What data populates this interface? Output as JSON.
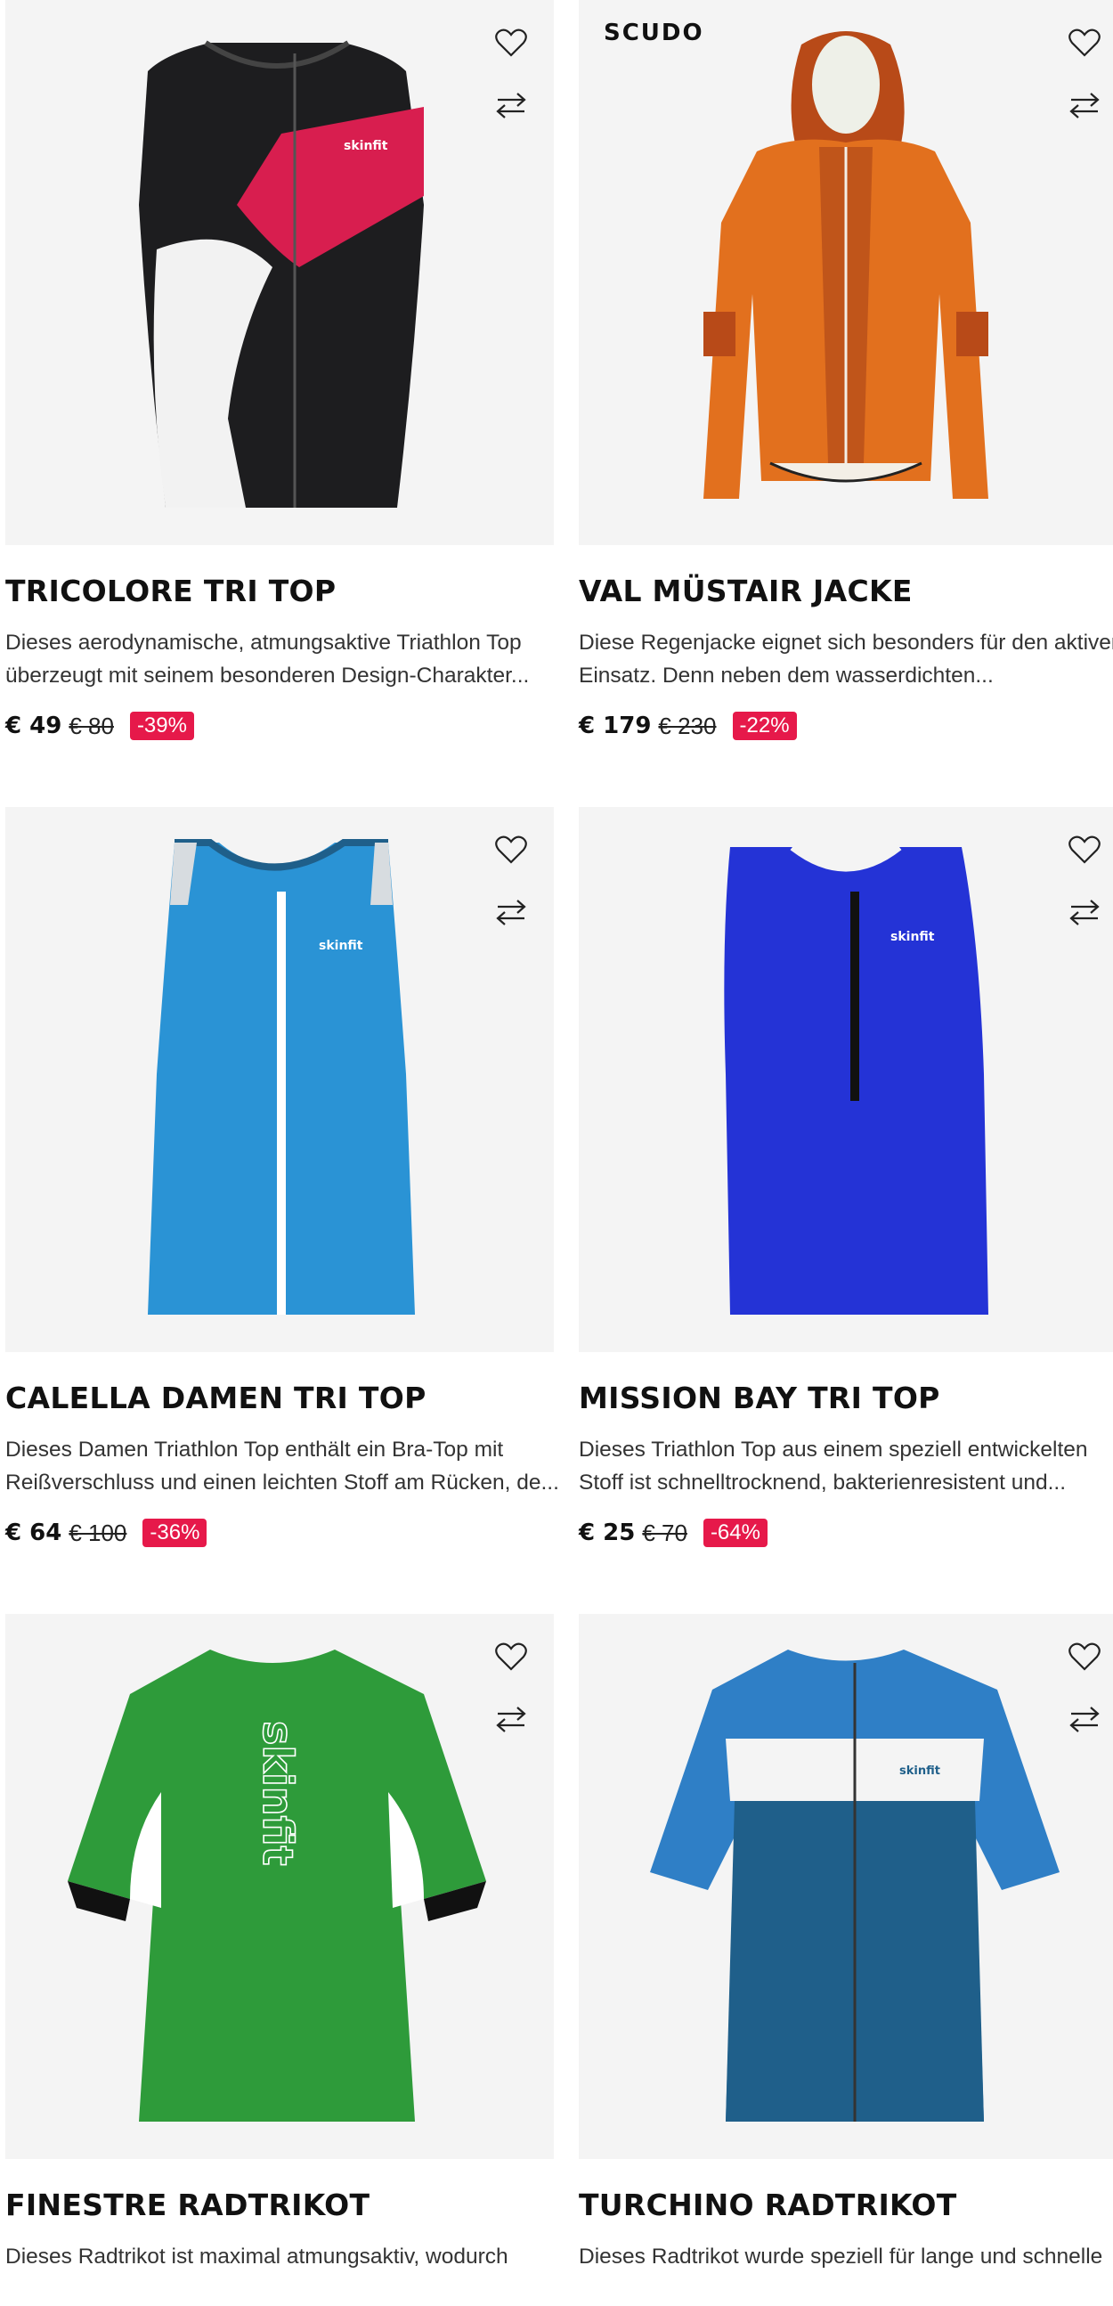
{
  "products": [
    {
      "title": "TRICOLORE TRI TOP",
      "desc1": "Dieses aerodynamische, atmungsaktive Triathlon Top",
      "desc2": "überzeugt mit seinem besonderen Design-Charakter...",
      "price": "€ 49",
      "old_price": "€ 80",
      "discount": "-39%",
      "brand": ""
    },
    {
      "title": "VAL MÜSTAIR JACKE",
      "desc1": "Diese Regenjacke eignet sich besonders für den aktiven",
      "desc2": "Einsatz. Denn neben dem wasserdichten...",
      "price": "€ 179",
      "old_price": "€ 230",
      "discount": "-22%",
      "brand": "SCUDO"
    },
    {
      "title": "CALELLA DAMEN TRI TOP",
      "desc1": "Dieses Damen Triathlon Top enthält ein Bra-Top mit",
      "desc2": "Reißverschluss und einen leichten Stoff am Rücken, de...",
      "price": "€ 64",
      "old_price": "€ 100",
      "discount": "-36%",
      "brand": ""
    },
    {
      "title": "MISSION BAY TRI TOP",
      "desc1": "Dieses Triathlon Top aus einem speziell entwickelten",
      "desc2": "Stoff ist schnelltrocknend, bakterienresistent und...",
      "price": "€ 25",
      "old_price": "€ 70",
      "discount": "-64%",
      "brand": ""
    },
    {
      "title": "FINESTRE RADTRIKOT",
      "desc1": "Dieses Radtrikot ist maximal atmungsaktiv, wodurch",
      "desc2": "",
      "price": "",
      "old_price": "",
      "discount": "",
      "brand": ""
    },
    {
      "title": "TURCHINO RADTRIKOT",
      "desc1": "Dieses Radtrikot wurde speziell für lange und schnelle",
      "desc2": "",
      "price": "",
      "old_price": "",
      "discount": "",
      "brand": ""
    }
  ],
  "icons": {
    "favorite": "heart-icon",
    "compare": "compare-arrows-icon"
  },
  "colors": {
    "discount_badge": "#e6194a",
    "image_bg": "#f4f4f4"
  }
}
